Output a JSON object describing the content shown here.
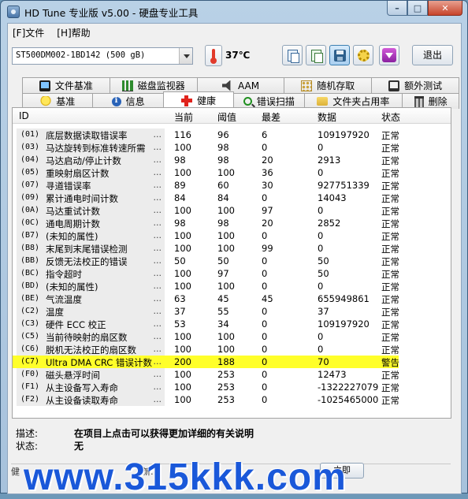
{
  "window": {
    "title": "HD Tune 专业版 v5.00 - 硬盘专业工具"
  },
  "menu": [
    {
      "label": "[F]文件"
    },
    {
      "label": "[H]帮助"
    }
  ],
  "toolbar": {
    "drive": "ST500DM002-1BD142 (500 gB)",
    "temperature": "37℃",
    "exit_label": "退出"
  },
  "tabs_top": [
    {
      "label": "文件基准",
      "icon": "monitor-icon"
    },
    {
      "label": "磁盘监视器",
      "icon": "bar-chart-icon"
    },
    {
      "label": "AAM",
      "icon": "speaker-icon"
    },
    {
      "label": "随机存取",
      "icon": "dots-icon"
    },
    {
      "label": "额外测试",
      "icon": "monitor-icon"
    }
  ],
  "tabs_bottom": [
    {
      "label": "基准",
      "icon": "bulb-icon"
    },
    {
      "label": "信息",
      "icon": "info-icon"
    },
    {
      "label": "健康",
      "icon": "cross-icon",
      "active": true
    },
    {
      "label": "错误扫描",
      "icon": "magnifier-icon"
    },
    {
      "label": "文件夹占用率",
      "icon": "folder-icon"
    },
    {
      "label": "删除",
      "icon": "trash-icon"
    }
  ],
  "health": {
    "columns": {
      "id": "ID",
      "current": "当前",
      "threshold": "阈值",
      "worst": "最差",
      "data": "数据",
      "status": "状态"
    },
    "rows": [
      {
        "code": "(01)",
        "name": "底层数据读取错误率",
        "current": "116",
        "threshold": "96",
        "worst": "6",
        "data": "109197920",
        "status": "正常"
      },
      {
        "code": "(03)",
        "name": "马达旋转到标准转速所需",
        "current": "100",
        "threshold": "98",
        "worst": "0",
        "data": "0",
        "status": "正常"
      },
      {
        "code": "(04)",
        "name": "马达启动/停止计数",
        "current": "98",
        "threshold": "98",
        "worst": "20",
        "data": "2913",
        "status": "正常"
      },
      {
        "code": "(05)",
        "name": "重映射扇区计数",
        "current": "100",
        "threshold": "100",
        "worst": "36",
        "data": "0",
        "status": "正常"
      },
      {
        "code": "(07)",
        "name": "寻道错误率",
        "current": "89",
        "threshold": "60",
        "worst": "30",
        "data": "927751339",
        "status": "正常"
      },
      {
        "code": "(09)",
        "name": "累计通电时间计数",
        "current": "84",
        "threshold": "84",
        "worst": "0",
        "data": "14043",
        "status": "正常"
      },
      {
        "code": "(0A)",
        "name": "马达重试计数",
        "current": "100",
        "threshold": "100",
        "worst": "97",
        "data": "0",
        "status": "正常"
      },
      {
        "code": "(0C)",
        "name": "通电周期计数",
        "current": "98",
        "threshold": "98",
        "worst": "20",
        "data": "2852",
        "status": "正常"
      },
      {
        "code": "(B7)",
        "name": "(未知的属性)",
        "current": "100",
        "threshold": "100",
        "worst": "0",
        "data": "0",
        "status": "正常"
      },
      {
        "code": "(B8)",
        "name": "末尾到末尾错误检测",
        "current": "100",
        "threshold": "100",
        "worst": "99",
        "data": "0",
        "status": "正常"
      },
      {
        "code": "(BB)",
        "name": "反馈无法校正的错误",
        "current": "50",
        "threshold": "50",
        "worst": "0",
        "data": "50",
        "status": "正常"
      },
      {
        "code": "(BC)",
        "name": "指令超时",
        "current": "100",
        "threshold": "97",
        "worst": "0",
        "data": "50",
        "status": "正常"
      },
      {
        "code": "(BD)",
        "name": "(未知的属性)",
        "current": "100",
        "threshold": "100",
        "worst": "0",
        "data": "0",
        "status": "正常"
      },
      {
        "code": "(BE)",
        "name": "气流温度",
        "current": "63",
        "threshold": "45",
        "worst": "45",
        "data": "655949861",
        "status": "正常"
      },
      {
        "code": "(C2)",
        "name": "温度",
        "current": "37",
        "threshold": "55",
        "worst": "0",
        "data": "37",
        "status": "正常"
      },
      {
        "code": "(C3)",
        "name": "硬件 ECC 校正",
        "current": "53",
        "threshold": "34",
        "worst": "0",
        "data": "109197920",
        "status": "正常"
      },
      {
        "code": "(C5)",
        "name": "当前待映射的扇区数",
        "current": "100",
        "threshold": "100",
        "worst": "0",
        "data": "0",
        "status": "正常"
      },
      {
        "code": "(C6)",
        "name": "脱机无法校正的扇区数",
        "current": "100",
        "threshold": "100",
        "worst": "0",
        "data": "0",
        "status": "正常"
      },
      {
        "code": "(C7)",
        "name": "Ultra DMA CRC 错误计数",
        "current": "200",
        "threshold": "188",
        "worst": "0",
        "data": "70",
        "status": "警告",
        "highlight": true
      },
      {
        "code": "(F0)",
        "name": "磁头悬浮时间",
        "current": "100",
        "threshold": "253",
        "worst": "0",
        "data": "12473",
        "status": "正常"
      },
      {
        "code": "(F1)",
        "name": "从主设备写入寿命",
        "current": "100",
        "threshold": "253",
        "worst": "0",
        "data": "-1322227079",
        "status": "正常"
      },
      {
        "code": "(F2)",
        "name": "从主设备读取寿命",
        "current": "100",
        "threshold": "253",
        "worst": "0",
        "data": "-1025465000",
        "status": "正常"
      }
    ]
  },
  "description": {
    "desc_label": "描述:",
    "desc_value": "在项目上点击可以获得更加详细的有关说明",
    "status_label": "状态:",
    "status_value": "无"
  },
  "bottom": {
    "left_text": "健",
    "mid_text": "新:",
    "button_label": "立即"
  },
  "watermark": "www.315kkk.com",
  "colors": {
    "highlight": "#ffff2a",
    "watermark": "#1a58d9"
  }
}
